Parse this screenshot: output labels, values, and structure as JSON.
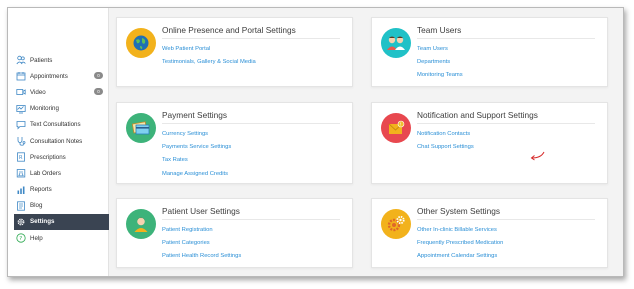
{
  "sidebar": {
    "items": [
      {
        "label": "Patients",
        "icon": "patients-icon"
      },
      {
        "label": "Appointments",
        "icon": "calendar-icon",
        "badge": "0"
      },
      {
        "label": "Video",
        "icon": "video-icon",
        "badge": "0"
      },
      {
        "label": "Monitoring",
        "icon": "monitoring-icon"
      },
      {
        "label": "Text Consultations",
        "icon": "chat-icon"
      },
      {
        "label": "Consultation Notes",
        "icon": "stethoscope-icon"
      },
      {
        "label": "Prescriptions",
        "icon": "prescription-icon"
      },
      {
        "label": "Lab Orders",
        "icon": "flask-icon"
      },
      {
        "label": "Reports",
        "icon": "reports-icon"
      },
      {
        "label": "Blog",
        "icon": "blog-icon"
      },
      {
        "label": "Settings",
        "icon": "gear-icon",
        "active": true
      },
      {
        "label": "Help",
        "icon": "help-icon"
      }
    ]
  },
  "cards": {
    "online": {
      "title": "Online Presence and Portal Settings",
      "links": [
        "Web Patient Portal",
        "Testimonials, Gallery & Social Media"
      ]
    },
    "team": {
      "title": "Team Users",
      "links": [
        "Team Users",
        "Departments",
        "Monitoring Teams"
      ]
    },
    "payment": {
      "title": "Payment Settings",
      "links": [
        "Currency Settings",
        "Payments Service Settings",
        "Tax Rates",
        "Manage Assigned Credits"
      ]
    },
    "notification": {
      "title": "Notification and Support Settings",
      "links": [
        "Notification Contacts",
        "Chat Support Settings"
      ]
    },
    "patient_user": {
      "title": "Patient User Settings",
      "links": [
        "Patient Registration",
        "Patient Categories",
        "Patient Health Record Settings"
      ]
    },
    "other": {
      "title": "Other System Settings",
      "links": [
        "Other In-clinic Billable Services",
        "Frequently Prescribed Medication",
        "Appointment Calendar Settings"
      ]
    }
  },
  "colors": {
    "link": "#2a8fd6",
    "sidebar_active": "#3a4452",
    "online_circle": "#f2b21c",
    "team_circle": "#20c1c7",
    "payment_circle": "#3db37a",
    "notification_circle": "#e8484f",
    "patient_user_circle": "#3db37a",
    "other_circle": "#f2b21c",
    "annotation_arrow": "#d62b2b"
  }
}
